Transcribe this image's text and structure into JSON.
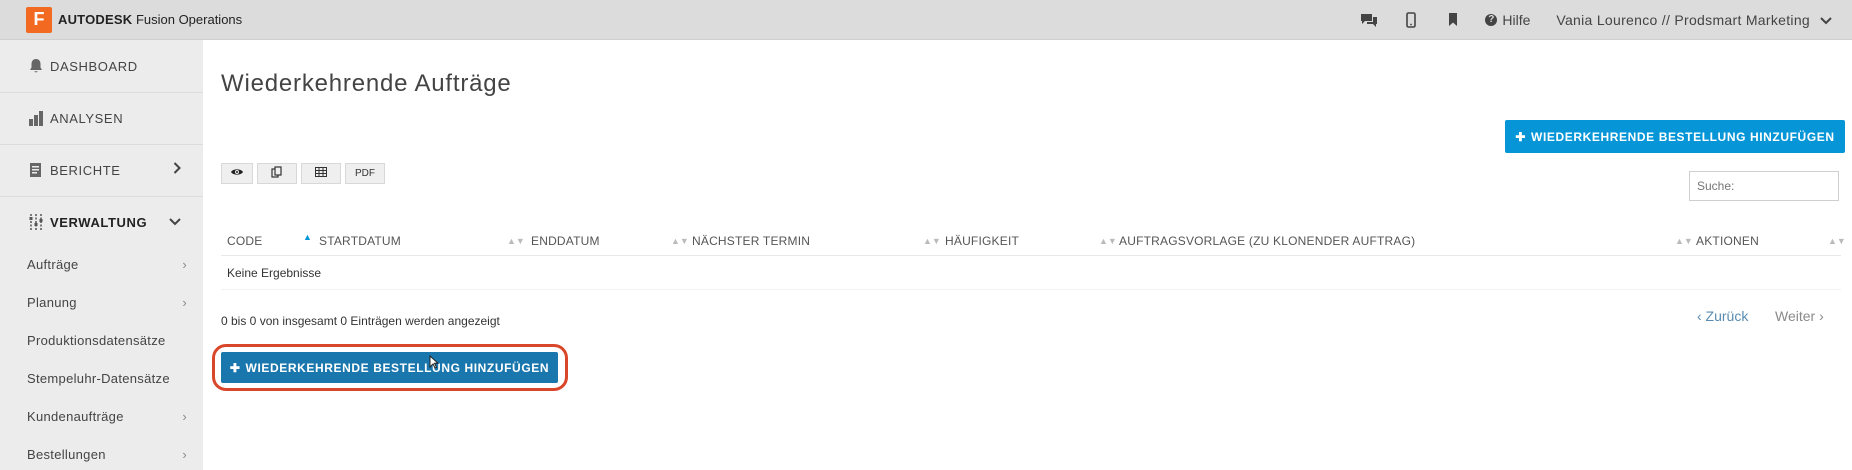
{
  "app": {
    "logo_letter": "F",
    "brand": "AUTODESK",
    "product": "Fusion Operations",
    "accent": "#f26a21"
  },
  "topbar": {
    "icons": [
      "chat-icon",
      "mobile-icon",
      "bookmark-icon"
    ],
    "help_label": "Hilfe",
    "user_label": "Vania Lourenco // Prodsmart Marketing"
  },
  "sidebar": {
    "main_items": [
      {
        "label": "DASHBOARD",
        "icon": "bell-icon"
      },
      {
        "label": "ANALYSEN",
        "icon": "bar-chart-icon"
      },
      {
        "label": "BERICHTE",
        "icon": "report-icon"
      },
      {
        "label": "VERWALTUNG",
        "icon": "sliders-icon"
      }
    ],
    "sub_items": [
      {
        "label": "Aufträge",
        "has_arrow": true
      },
      {
        "label": "Planung",
        "has_arrow": true
      },
      {
        "label": "Produktionsdatensätze",
        "has_arrow": false
      },
      {
        "label": "Stempeluhr-Datensätze",
        "has_arrow": false
      },
      {
        "label": "Kundenaufträge",
        "has_arrow": true
      },
      {
        "label": "Bestellungen",
        "has_arrow": true
      }
    ]
  },
  "main": {
    "title": "Wiederkehrende Aufträge",
    "add_button_label": "WIEDERKEHRENDE BESTELLUNG HINZUFÜGEN",
    "toolbar": {
      "pdf_label": "PDF"
    },
    "search_placeholder": "Suche:",
    "table": {
      "columns": [
        "CODE",
        "STARTDATUM",
        "ENDDATUM",
        "NÄCHSTER TERMIN",
        "HÄUFIGKEIT",
        "AUFTRAGSVORLAGE (ZU KLONENDER AUFTRAG)",
        "AKTIONEN"
      ],
      "empty_text": "Keine Ergebnisse"
    },
    "info_text": "0 bis 0 von insgesamt 0 Einträgen werden angezeigt",
    "pager": {
      "prev_label": "‹ Zurück",
      "next_label": "Weiter ›"
    }
  },
  "colors": {
    "primary_button": "#0696d7",
    "bottom_button": "#1a77ad",
    "highlight_border": "#d9472b"
  }
}
